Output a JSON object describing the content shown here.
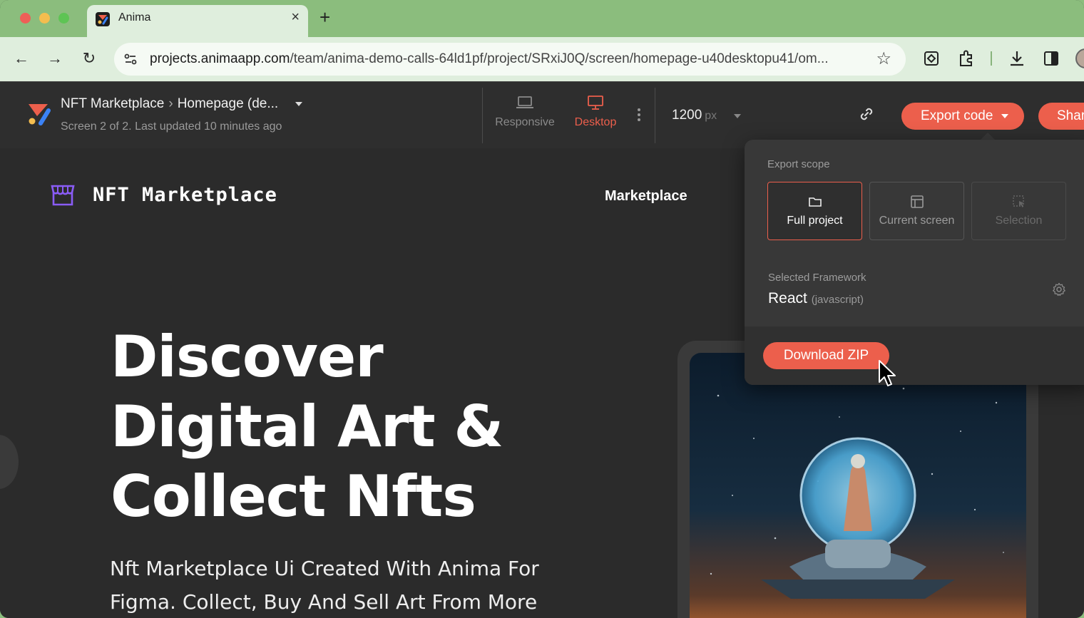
{
  "browser": {
    "tab_title": "Anima",
    "tab_close": "×",
    "new_tab": "+",
    "url_domain": "projects.animaapp.com",
    "url_path": "/team/anima-demo-calls-64ld1pf/project/SRxiJ0Q/screen/homepage-u40desktopu41/om...",
    "back": "←",
    "forward": "→",
    "reload": "↻",
    "bookmark": "☆"
  },
  "anima": {
    "project": "NFT Marketplace",
    "screen": "Homepage (de...",
    "breadcrumb_sep": "›",
    "subline": "Screen 2 of 2. Last updated 10 minutes ago",
    "view_responsive": "Responsive",
    "view_desktop": "Desktop",
    "width_value": "1200",
    "width_unit": "px",
    "export_label": "Export code",
    "share_label": "Shar",
    "accent": "#ec5f4c"
  },
  "export_panel": {
    "scope_label": "Export scope",
    "scope_full": "Full project",
    "scope_current": "Current screen",
    "scope_selection": "Selection",
    "framework_label": "Selected Framework",
    "framework_name": "React",
    "framework_lang": "(javascript)",
    "download_label": "Download ZIP"
  },
  "site": {
    "logo_text": "NFT Marketplace",
    "nav_item": "Marketplace",
    "hero_line1": "Discover",
    "hero_line2": "Digital Art &",
    "hero_line3": "Collect Nfts",
    "hero_sub": "Nft Marketplace Ui Created With Anima For Figma. Collect, Buy And Sell Art From More"
  }
}
